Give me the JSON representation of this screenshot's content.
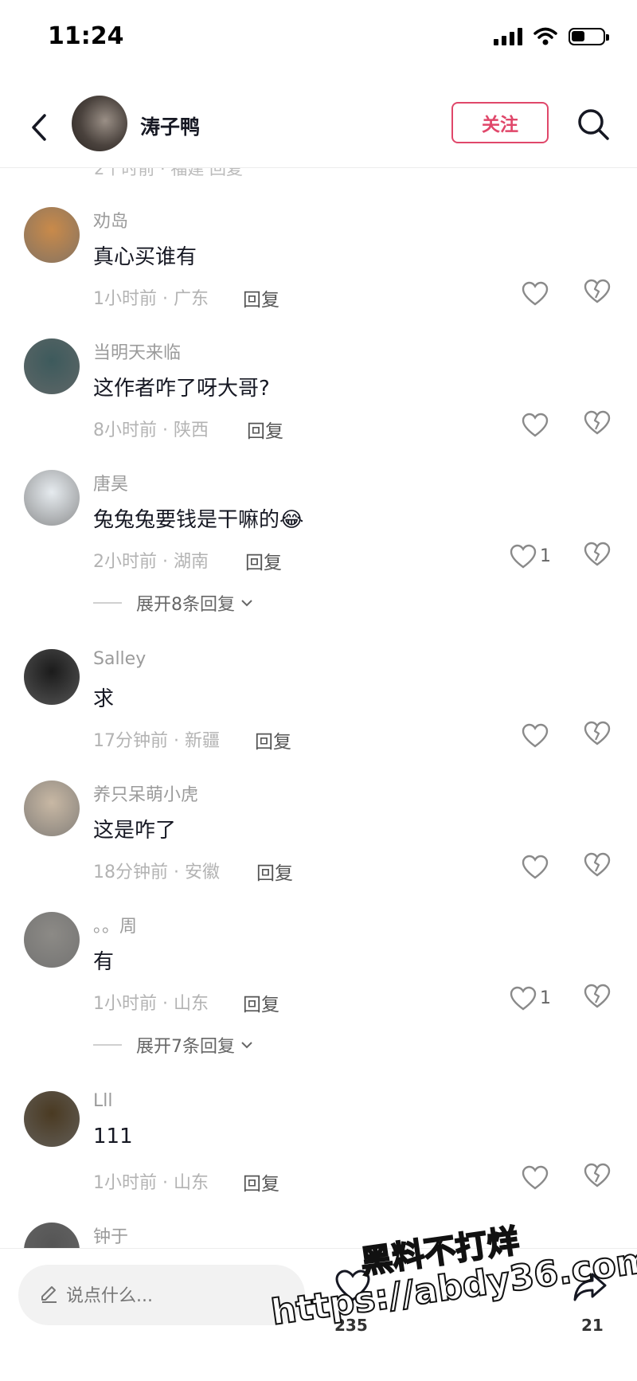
{
  "status": {
    "time": "11:24"
  },
  "header": {
    "name": "涛子鸭",
    "follow_label": "关注"
  },
  "peek_text": "2个时前 · 福建    回复",
  "comments": [
    {
      "name": "劝岛",
      "text": "真心买谁有",
      "meta": "1小时前 · 广东",
      "reply": "回复",
      "likes": "",
      "expand": "",
      "avatar_color": "#c98a4a"
    },
    {
      "name": "当明天来临",
      "text": "这作者咋了呀大哥?",
      "meta": "8小时前 · 陕西",
      "reply": "回复",
      "likes": "",
      "expand": "",
      "avatar_color": "#3d5a5c"
    },
    {
      "name": "唐昊",
      "text": "兔兔兔要钱是干嘛的😂",
      "meta": "2小时前 · 湖南",
      "reply": "回复",
      "likes": "1",
      "expand": "展开8条回复",
      "avatar_color": "#e6ebef"
    },
    {
      "name": "Salley",
      "text": "求",
      "meta": "17分钟前 · 新疆",
      "reply": "回复",
      "likes": "",
      "expand": "",
      "avatar_color": "#1b1b1b"
    },
    {
      "name": "养只呆萌小虎",
      "text": "这是咋了",
      "meta": "18分钟前 · 安徽",
      "reply": "回复",
      "likes": "",
      "expand": "",
      "avatar_color": "#c8b8a4"
    },
    {
      "name": "。。周",
      "text": "有",
      "meta": "1小时前 · 山东",
      "reply": "回复",
      "likes": "1",
      "expand": "展开7条回复",
      "avatar_color": "#8c8a86"
    },
    {
      "name": "Lll",
      "text": "111",
      "meta": "1小时前 · 山东",
      "reply": "回复",
      "likes": "",
      "expand": "",
      "avatar_color": "#4a3a22"
    },
    {
      "name": "钟于",
      "text": "",
      "meta": "",
      "reply": "",
      "likes": "",
      "expand": "",
      "avatar_color": "#555555"
    }
  ],
  "bottom": {
    "placeholder": "说点什么...",
    "like_count": "235",
    "share_count": "21"
  },
  "watermark": {
    "line1": "黑料不打烊",
    "line2": "https://abdy36.com"
  },
  "colors": {
    "accent": "#e0476a",
    "text": "#161823",
    "meta": "#b3b3b3"
  }
}
